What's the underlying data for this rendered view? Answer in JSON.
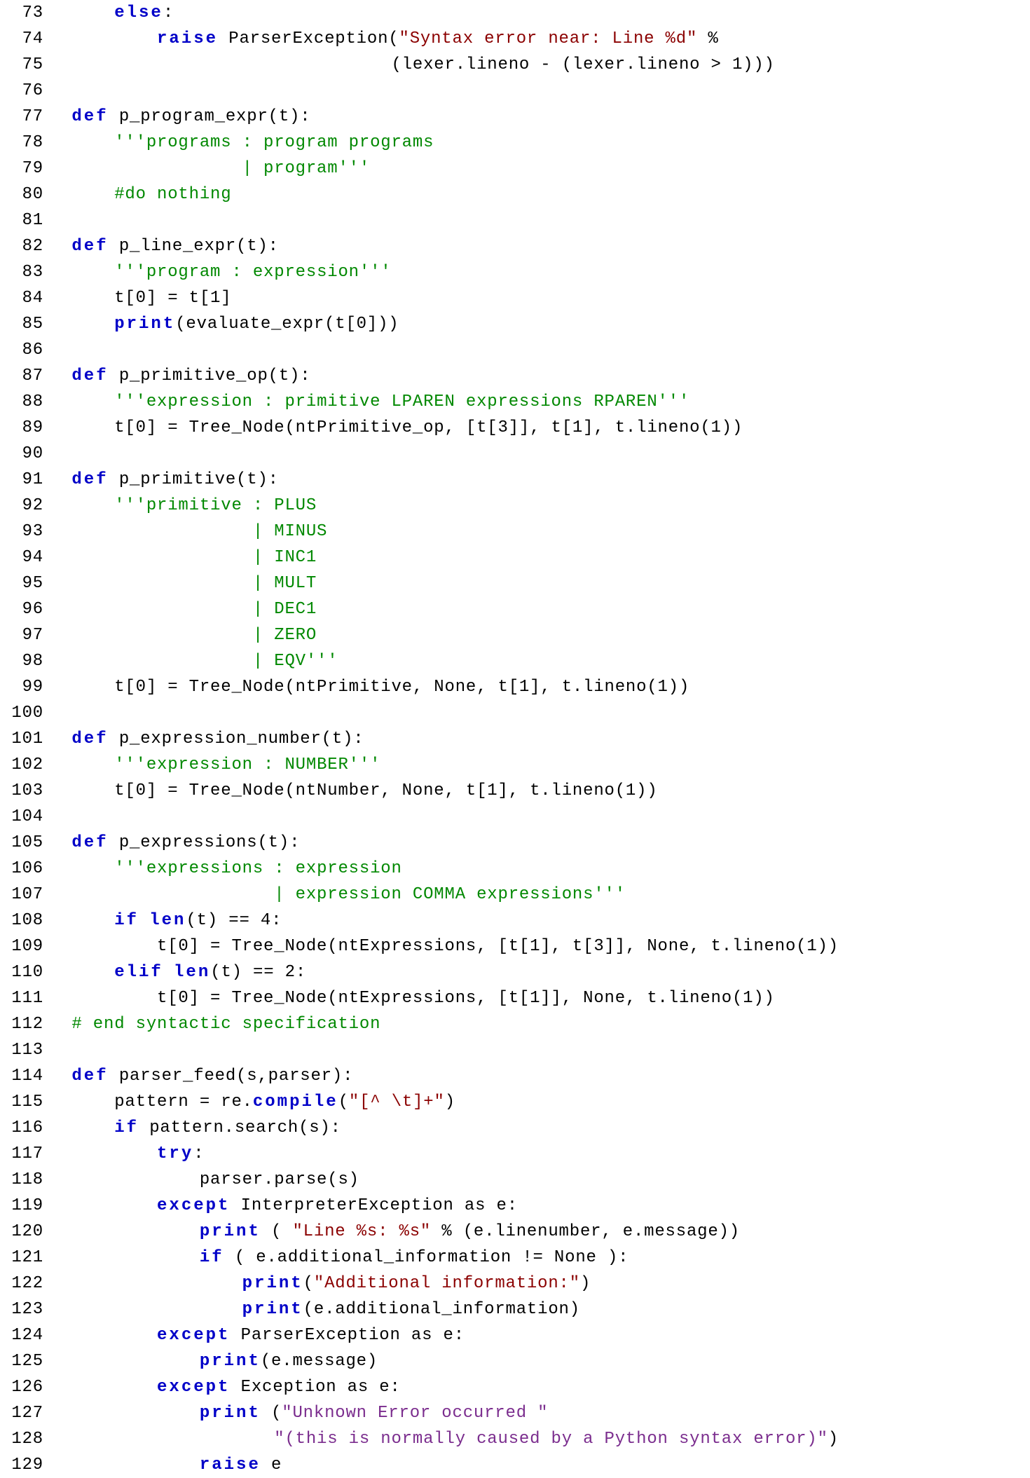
{
  "lines": [
    {
      "n": "73",
      "tokens": [
        {
          "t": "      ",
          "c": ""
        },
        {
          "t": "else",
          "c": "kw"
        },
        {
          "t": ":",
          "c": ""
        }
      ]
    },
    {
      "n": "74",
      "tokens": [
        {
          "t": "          ",
          "c": ""
        },
        {
          "t": "raise",
          "c": "kw"
        },
        {
          "t": " ParserException(",
          "c": ""
        },
        {
          "t": "\"Syntax error near: Line %d\"",
          "c": "str"
        },
        {
          "t": " %",
          "c": ""
        }
      ]
    },
    {
      "n": "75",
      "tokens": [
        {
          "t": "                                (lexer.lineno - (lexer.lineno > 1)))",
          "c": ""
        }
      ]
    },
    {
      "n": "76",
      "tokens": [
        {
          "t": "",
          "c": ""
        }
      ]
    },
    {
      "n": "77",
      "tokens": [
        {
          "t": "  ",
          "c": ""
        },
        {
          "t": "def",
          "c": "kw"
        },
        {
          "t": " p_program_expr(t):",
          "c": ""
        }
      ]
    },
    {
      "n": "78",
      "tokens": [
        {
          "t": "      ",
          "c": ""
        },
        {
          "t": "'''programs : program programs",
          "c": "com"
        }
      ]
    },
    {
      "n": "79",
      "tokens": [
        {
          "t": "                  | program'''",
          "c": "com"
        }
      ]
    },
    {
      "n": "80",
      "tokens": [
        {
          "t": "      ",
          "c": ""
        },
        {
          "t": "#do nothing",
          "c": "com"
        }
      ]
    },
    {
      "n": "81",
      "tokens": [
        {
          "t": "",
          "c": ""
        }
      ]
    },
    {
      "n": "82",
      "tokens": [
        {
          "t": "  ",
          "c": ""
        },
        {
          "t": "def",
          "c": "kw"
        },
        {
          "t": " p_line_expr(t):",
          "c": ""
        }
      ]
    },
    {
      "n": "83",
      "tokens": [
        {
          "t": "      ",
          "c": ""
        },
        {
          "t": "'''program : expression'''",
          "c": "com"
        }
      ]
    },
    {
      "n": "84",
      "tokens": [
        {
          "t": "      t[0] = t[1]",
          "c": ""
        }
      ]
    },
    {
      "n": "85",
      "tokens": [
        {
          "t": "      ",
          "c": ""
        },
        {
          "t": "print",
          "c": "kw"
        },
        {
          "t": "(evaluate_expr(t[0]))",
          "c": ""
        }
      ]
    },
    {
      "n": "86",
      "tokens": [
        {
          "t": "",
          "c": ""
        }
      ]
    },
    {
      "n": "87",
      "tokens": [
        {
          "t": "  ",
          "c": ""
        },
        {
          "t": "def",
          "c": "kw"
        },
        {
          "t": " p_primitive_op(t):",
          "c": ""
        }
      ]
    },
    {
      "n": "88",
      "tokens": [
        {
          "t": "      ",
          "c": ""
        },
        {
          "t": "'''expression : primitive LPAREN expressions RPAREN'''",
          "c": "com"
        }
      ]
    },
    {
      "n": "89",
      "tokens": [
        {
          "t": "      t[0] = Tree_Node(ntPrimitive_op, [t[3]], t[1], t.lineno(1))",
          "c": ""
        }
      ]
    },
    {
      "n": "90",
      "tokens": [
        {
          "t": "",
          "c": ""
        }
      ]
    },
    {
      "n": "91",
      "tokens": [
        {
          "t": "  ",
          "c": ""
        },
        {
          "t": "def",
          "c": "kw"
        },
        {
          "t": " p_primitive(t):",
          "c": ""
        }
      ]
    },
    {
      "n": "92",
      "tokens": [
        {
          "t": "      ",
          "c": ""
        },
        {
          "t": "'''primitive : PLUS",
          "c": "com"
        }
      ]
    },
    {
      "n": "93",
      "tokens": [
        {
          "t": "                   | MINUS",
          "c": "com"
        }
      ]
    },
    {
      "n": "94",
      "tokens": [
        {
          "t": "                   | INC1",
          "c": "com"
        }
      ]
    },
    {
      "n": "95",
      "tokens": [
        {
          "t": "                   | MULT",
          "c": "com"
        }
      ]
    },
    {
      "n": "96",
      "tokens": [
        {
          "t": "                   | DEC1",
          "c": "com"
        }
      ]
    },
    {
      "n": "97",
      "tokens": [
        {
          "t": "                   | ZERO",
          "c": "com"
        }
      ]
    },
    {
      "n": "98",
      "tokens": [
        {
          "t": "                   | EQV'''",
          "c": "com"
        }
      ]
    },
    {
      "n": "99",
      "tokens": [
        {
          "t": "      t[0] = Tree_Node(ntPrimitive, None, t[1], t.lineno(1))",
          "c": ""
        }
      ]
    },
    {
      "n": "100",
      "tokens": [
        {
          "t": "",
          "c": ""
        }
      ]
    },
    {
      "n": "101",
      "tokens": [
        {
          "t": "  ",
          "c": ""
        },
        {
          "t": "def",
          "c": "kw"
        },
        {
          "t": " p_expression_number(t):",
          "c": ""
        }
      ]
    },
    {
      "n": "102",
      "tokens": [
        {
          "t": "      ",
          "c": ""
        },
        {
          "t": "'''expression : NUMBER'''",
          "c": "com"
        }
      ]
    },
    {
      "n": "103",
      "tokens": [
        {
          "t": "      t[0] = Tree_Node(ntNumber, None, t[1], t.lineno(1))",
          "c": ""
        }
      ]
    },
    {
      "n": "104",
      "tokens": [
        {
          "t": "",
          "c": ""
        }
      ]
    },
    {
      "n": "105",
      "tokens": [
        {
          "t": "  ",
          "c": ""
        },
        {
          "t": "def",
          "c": "kw"
        },
        {
          "t": " p_expressions(t):",
          "c": ""
        }
      ]
    },
    {
      "n": "106",
      "tokens": [
        {
          "t": "      ",
          "c": ""
        },
        {
          "t": "'''expressions : expression",
          "c": "com"
        }
      ]
    },
    {
      "n": "107",
      "tokens": [
        {
          "t": "                     | expression COMMA expressions'''",
          "c": "com"
        }
      ]
    },
    {
      "n": "108",
      "tokens": [
        {
          "t": "      ",
          "c": ""
        },
        {
          "t": "if",
          "c": "kw"
        },
        {
          "t": " ",
          "c": ""
        },
        {
          "t": "len",
          "c": "kw"
        },
        {
          "t": "(t) == 4:",
          "c": ""
        }
      ]
    },
    {
      "n": "109",
      "tokens": [
        {
          "t": "          t[0] = Tree_Node(ntExpressions, [t[1], t[3]], None, t.lineno(1))",
          "c": ""
        }
      ]
    },
    {
      "n": "110",
      "tokens": [
        {
          "t": "      ",
          "c": ""
        },
        {
          "t": "elif",
          "c": "kw"
        },
        {
          "t": " ",
          "c": ""
        },
        {
          "t": "len",
          "c": "kw"
        },
        {
          "t": "(t) == 2:",
          "c": ""
        }
      ]
    },
    {
      "n": "111",
      "tokens": [
        {
          "t": "          t[0] = Tree_Node(ntExpressions, [t[1]], None, t.lineno(1))",
          "c": ""
        }
      ]
    },
    {
      "n": "112",
      "tokens": [
        {
          "t": "  ",
          "c": ""
        },
        {
          "t": "# end syntactic specification",
          "c": "com"
        }
      ]
    },
    {
      "n": "113",
      "tokens": [
        {
          "t": "",
          "c": ""
        }
      ]
    },
    {
      "n": "114",
      "tokens": [
        {
          "t": "  ",
          "c": ""
        },
        {
          "t": "def",
          "c": "kw"
        },
        {
          "t": " parser_feed(s,parser):",
          "c": ""
        }
      ]
    },
    {
      "n": "115",
      "tokens": [
        {
          "t": "      pattern = re.",
          "c": ""
        },
        {
          "t": "compile",
          "c": "kw"
        },
        {
          "t": "(",
          "c": ""
        },
        {
          "t": "\"[^ \\t]+\"",
          "c": "str"
        },
        {
          "t": ")",
          "c": ""
        }
      ]
    },
    {
      "n": "116",
      "tokens": [
        {
          "t": "      ",
          "c": ""
        },
        {
          "t": "if",
          "c": "kw"
        },
        {
          "t": " pattern.search(s):",
          "c": ""
        }
      ]
    },
    {
      "n": "117",
      "tokens": [
        {
          "t": "          ",
          "c": ""
        },
        {
          "t": "try",
          "c": "kw"
        },
        {
          "t": ":",
          "c": ""
        }
      ]
    },
    {
      "n": "118",
      "tokens": [
        {
          "t": "              parser.parse(s)",
          "c": ""
        }
      ]
    },
    {
      "n": "119",
      "tokens": [
        {
          "t": "          ",
          "c": ""
        },
        {
          "t": "except",
          "c": "kw"
        },
        {
          "t": " InterpreterException as e:",
          "c": ""
        }
      ]
    },
    {
      "n": "120",
      "tokens": [
        {
          "t": "              ",
          "c": ""
        },
        {
          "t": "print",
          "c": "kw"
        },
        {
          "t": " ( ",
          "c": ""
        },
        {
          "t": "\"Line %s: %s\"",
          "c": "str"
        },
        {
          "t": " % (e.linenumber, e.message))",
          "c": ""
        }
      ]
    },
    {
      "n": "121",
      "tokens": [
        {
          "t": "              ",
          "c": ""
        },
        {
          "t": "if",
          "c": "kw"
        },
        {
          "t": " ( e.additional_information != None ):",
          "c": ""
        }
      ]
    },
    {
      "n": "122",
      "tokens": [
        {
          "t": "                  ",
          "c": ""
        },
        {
          "t": "print",
          "c": "kw"
        },
        {
          "t": "(",
          "c": ""
        },
        {
          "t": "\"Additional information:\"",
          "c": "str"
        },
        {
          "t": ")",
          "c": ""
        }
      ]
    },
    {
      "n": "123",
      "tokens": [
        {
          "t": "                  ",
          "c": ""
        },
        {
          "t": "print",
          "c": "kw"
        },
        {
          "t": "(e.additional_information)",
          "c": ""
        }
      ]
    },
    {
      "n": "124",
      "tokens": [
        {
          "t": "          ",
          "c": ""
        },
        {
          "t": "except",
          "c": "kw"
        },
        {
          "t": " ParserException as e:",
          "c": ""
        }
      ]
    },
    {
      "n": "125",
      "tokens": [
        {
          "t": "              ",
          "c": ""
        },
        {
          "t": "print",
          "c": "kw"
        },
        {
          "t": "(e.message)",
          "c": ""
        }
      ]
    },
    {
      "n": "126",
      "tokens": [
        {
          "t": "          ",
          "c": ""
        },
        {
          "t": "except",
          "c": "kw"
        },
        {
          "t": " Exception as e:",
          "c": ""
        }
      ]
    },
    {
      "n": "127",
      "tokens": [
        {
          "t": "              ",
          "c": ""
        },
        {
          "t": "print",
          "c": "kw"
        },
        {
          "t": " (",
          "c": ""
        },
        {
          "t": "\"Unknown Error occurred \"",
          "c": "bi"
        }
      ]
    },
    {
      "n": "128",
      "tokens": [
        {
          "t": "                     ",
          "c": ""
        },
        {
          "t": "\"(this is normally caused by a Python syntax error)\"",
          "c": "bi"
        },
        {
          "t": ")",
          "c": ""
        }
      ]
    },
    {
      "n": "129",
      "tokens": [
        {
          "t": "              ",
          "c": ""
        },
        {
          "t": "raise",
          "c": "kw"
        },
        {
          "t": " e",
          "c": ""
        }
      ]
    }
  ]
}
